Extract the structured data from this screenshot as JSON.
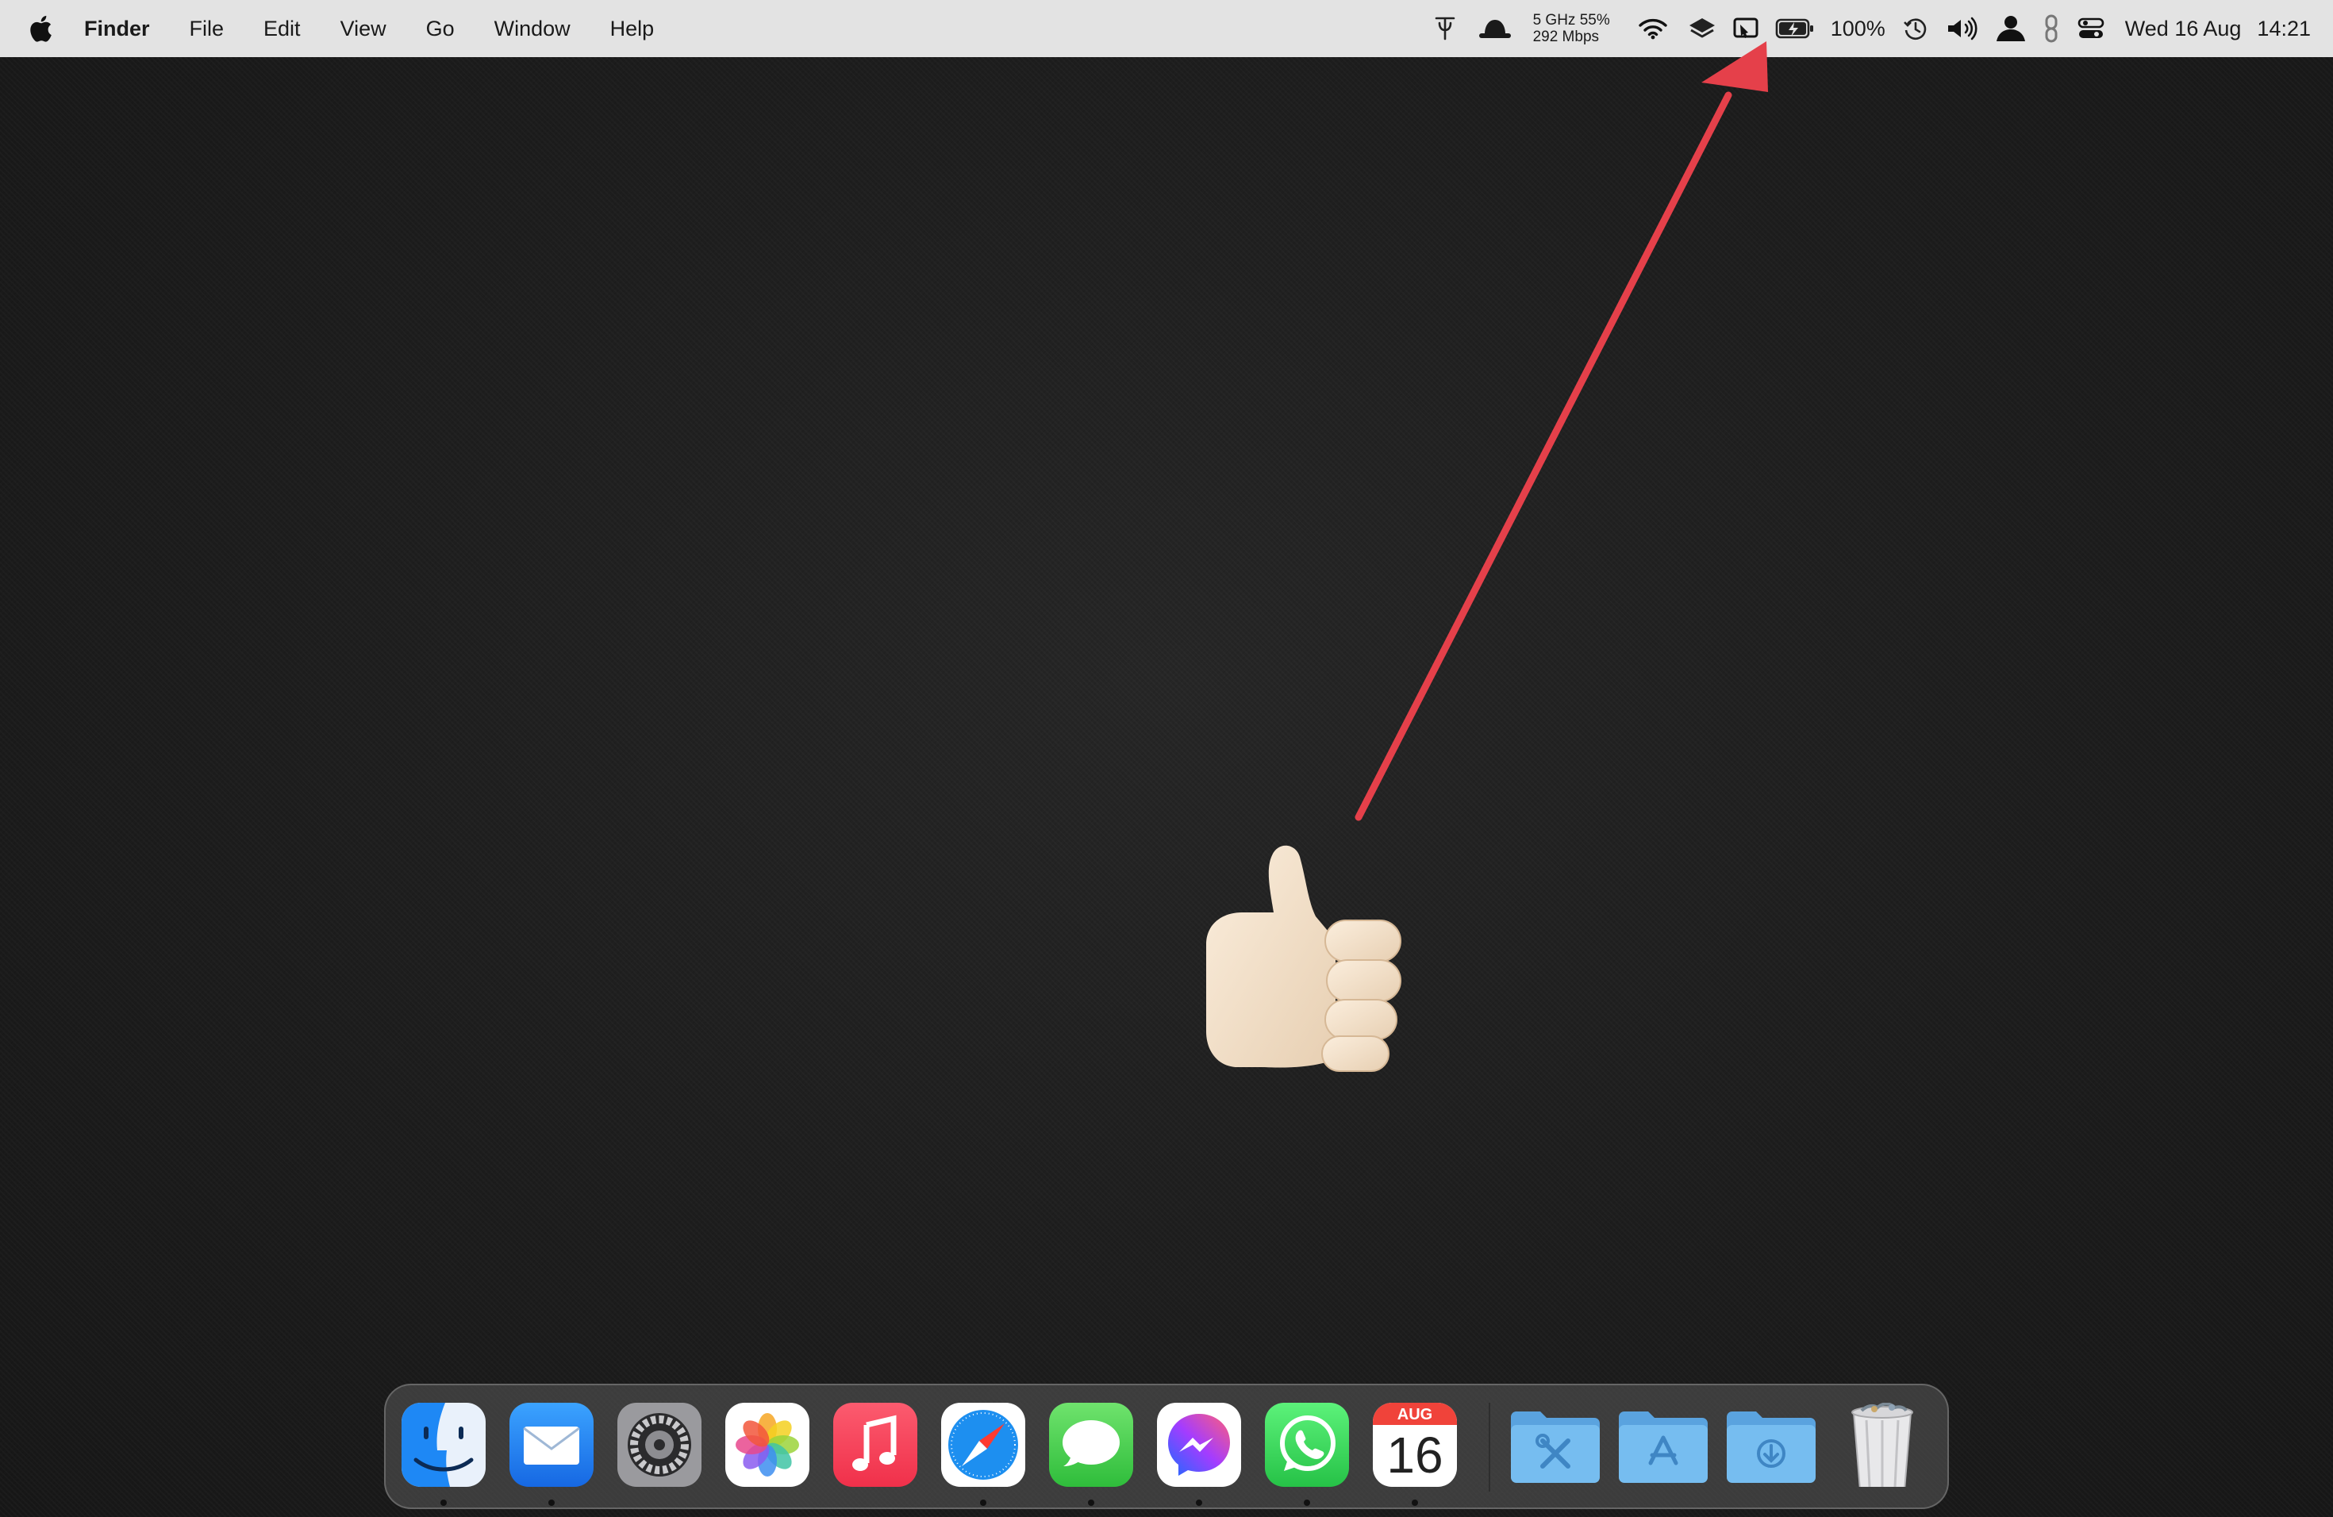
{
  "menubar": {
    "app_name": "Finder",
    "menus": [
      "File",
      "Edit",
      "View",
      "Go",
      "Window",
      "Help"
    ],
    "network": {
      "line1": "5 GHz 55%",
      "line2": "292 Mbps"
    },
    "battery_percent": "100%",
    "date": "Wed 16 Aug",
    "time": "14:21"
  },
  "dock": {
    "apps": [
      {
        "name": "Finder",
        "icon": "finder-icon",
        "running": true
      },
      {
        "name": "Mail",
        "icon": "mail-icon",
        "running": true
      },
      {
        "name": "System Settings",
        "icon": "settings-gear-icon",
        "running": false
      },
      {
        "name": "Photos",
        "icon": "photos-icon",
        "running": false
      },
      {
        "name": "Music",
        "icon": "music-icon",
        "running": false
      },
      {
        "name": "Safari",
        "icon": "safari-compass-icon",
        "running": true
      },
      {
        "name": "Messages",
        "icon": "messages-icon",
        "running": true
      },
      {
        "name": "Messenger",
        "icon": "messenger-icon",
        "running": true
      },
      {
        "name": "WhatsApp",
        "icon": "whatsapp-icon",
        "running": true
      },
      {
        "name": "Calendar",
        "icon": "calendar-icon",
        "running": true
      }
    ],
    "calendar": {
      "month": "AUG",
      "day": "16"
    },
    "folders": [
      {
        "name": "Utilities",
        "icon": "utilities-folder-icon"
      },
      {
        "name": "Applications",
        "icon": "applications-folder-icon"
      },
      {
        "name": "Downloads",
        "icon": "downloads-folder-icon"
      }
    ],
    "trash": {
      "name": "Trash",
      "icon": "trash-full-icon"
    }
  },
  "colors": {
    "menubar_bg": "#e3e3e3",
    "desktop_bg": "#1d1d1d",
    "annotation_arrow": "#e5404a",
    "folder_blue": "#6fb3e6"
  }
}
